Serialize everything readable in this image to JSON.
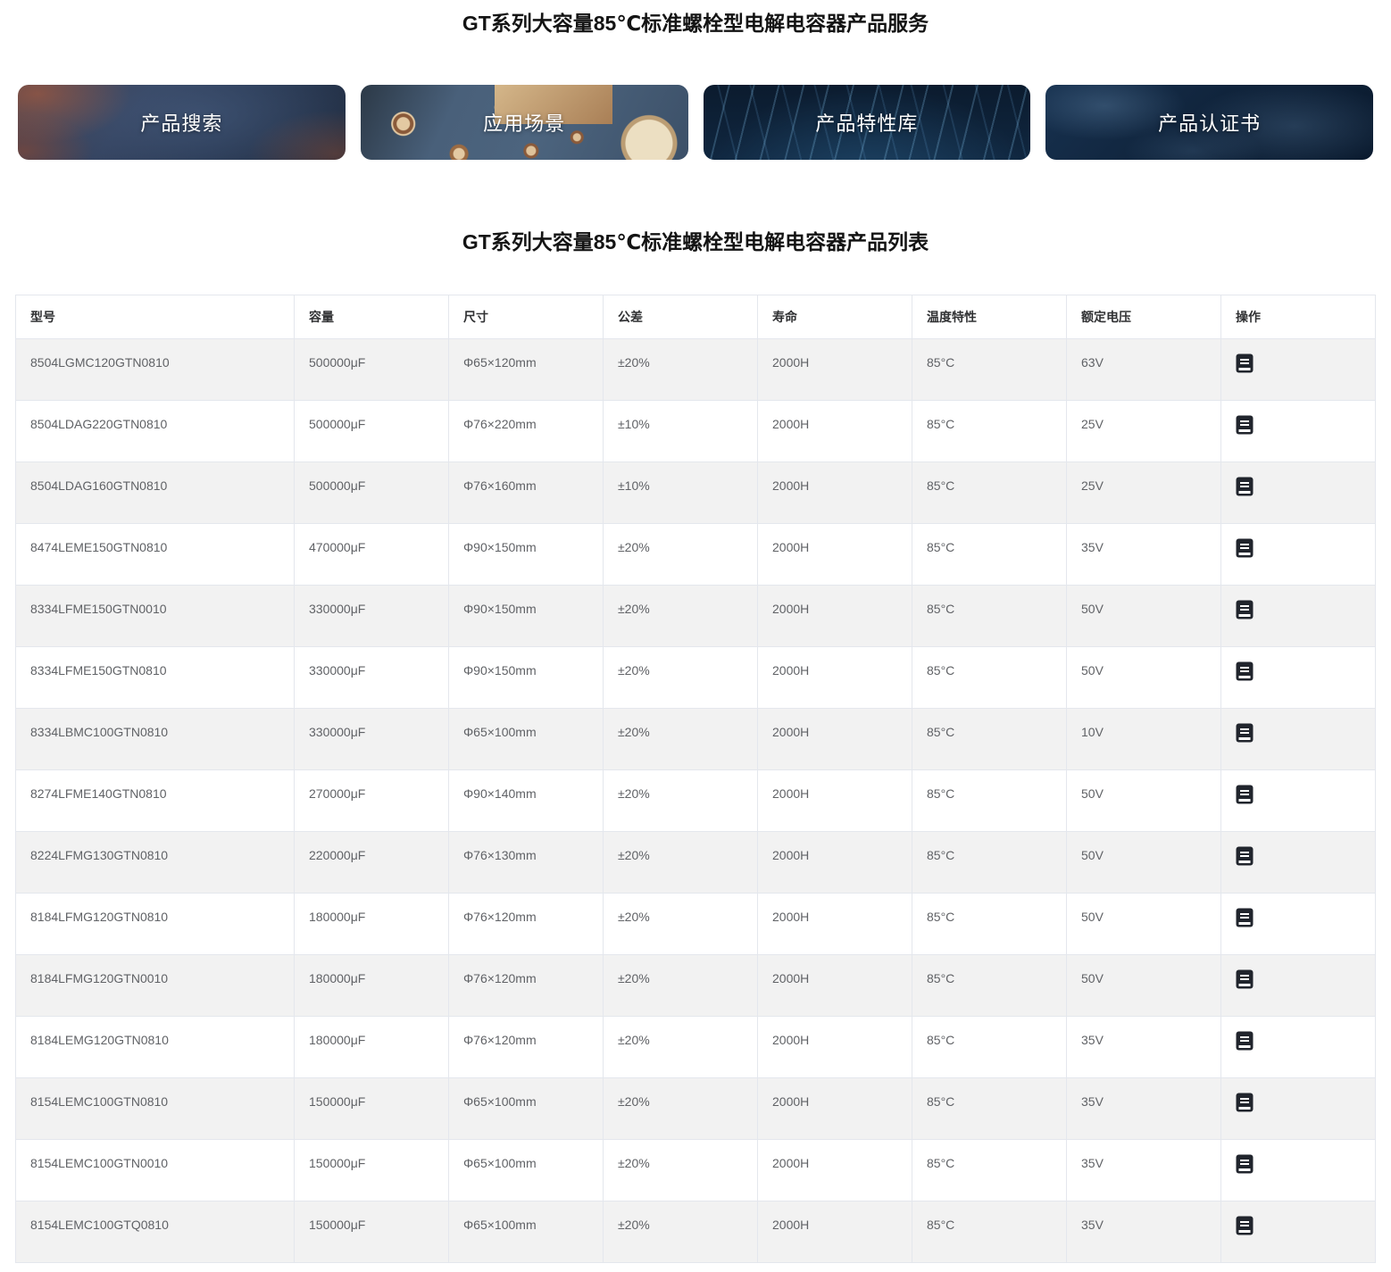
{
  "titles": {
    "service": "GT系列大容量85℃标准螺栓型电解电容器产品服务",
    "list": "GT系列大容量85℃标准螺栓型电解电容器产品列表"
  },
  "nav_cards": [
    {
      "id": "product-search",
      "label": "产品搜索"
    },
    {
      "id": "application-scenes",
      "label": "应用场景"
    },
    {
      "id": "feature-library",
      "label": "产品特性库"
    },
    {
      "id": "certificates",
      "label": "产品认证书"
    }
  ],
  "table": {
    "columns": [
      {
        "key": "model",
        "label": "型号"
      },
      {
        "key": "capacity",
        "label": "容量"
      },
      {
        "key": "size",
        "label": "尺寸"
      },
      {
        "key": "tolerance",
        "label": "公差"
      },
      {
        "key": "life",
        "label": "寿命"
      },
      {
        "key": "temperature",
        "label": "温度特性"
      },
      {
        "key": "voltage",
        "label": "额定电压"
      },
      {
        "key": "action",
        "label": "操作"
      }
    ],
    "action_icon": "document-icon",
    "rows": [
      {
        "model": "8504LGMC120GTN0810",
        "capacity": "500000μF",
        "size": "Φ65×120mm",
        "tolerance": "±20%",
        "life": "2000H",
        "temperature": "85°C",
        "voltage": "63V"
      },
      {
        "model": "8504LDAG220GTN0810",
        "capacity": "500000μF",
        "size": "Φ76×220mm",
        "tolerance": "±10%",
        "life": "2000H",
        "temperature": "85°C",
        "voltage": "25V"
      },
      {
        "model": "8504LDAG160GTN0810",
        "capacity": "500000μF",
        "size": "Φ76×160mm",
        "tolerance": "±10%",
        "life": "2000H",
        "temperature": "85°C",
        "voltage": "25V"
      },
      {
        "model": "8474LEME150GTN0810",
        "capacity": "470000μF",
        "size": "Φ90×150mm",
        "tolerance": "±20%",
        "life": "2000H",
        "temperature": "85°C",
        "voltage": "35V"
      },
      {
        "model": "8334LFME150GTN0010",
        "capacity": "330000μF",
        "size": "Φ90×150mm",
        "tolerance": "±20%",
        "life": "2000H",
        "temperature": "85°C",
        "voltage": "50V"
      },
      {
        "model": "8334LFME150GTN0810",
        "capacity": "330000μF",
        "size": "Φ90×150mm",
        "tolerance": "±20%",
        "life": "2000H",
        "temperature": "85°C",
        "voltage": "50V"
      },
      {
        "model": "8334LBMC100GTN0810",
        "capacity": "330000μF",
        "size": "Φ65×100mm",
        "tolerance": "±20%",
        "life": "2000H",
        "temperature": "85°C",
        "voltage": "10V"
      },
      {
        "model": "8274LFME140GTN0810",
        "capacity": "270000μF",
        "size": "Φ90×140mm",
        "tolerance": "±20%",
        "life": "2000H",
        "temperature": "85°C",
        "voltage": "50V"
      },
      {
        "model": "8224LFMG130GTN0810",
        "capacity": "220000μF",
        "size": "Φ76×130mm",
        "tolerance": "±20%",
        "life": "2000H",
        "temperature": "85°C",
        "voltage": "50V"
      },
      {
        "model": "8184LFMG120GTN0810",
        "capacity": "180000μF",
        "size": "Φ76×120mm",
        "tolerance": "±20%",
        "life": "2000H",
        "temperature": "85°C",
        "voltage": "50V"
      },
      {
        "model": "8184LFMG120GTN0010",
        "capacity": "180000μF",
        "size": "Φ76×120mm",
        "tolerance": "±20%",
        "life": "2000H",
        "temperature": "85°C",
        "voltage": "50V"
      },
      {
        "model": "8184LEMG120GTN0810",
        "capacity": "180000μF",
        "size": "Φ76×120mm",
        "tolerance": "±20%",
        "life": "2000H",
        "temperature": "85°C",
        "voltage": "35V"
      },
      {
        "model": "8154LEMC100GTN0810",
        "capacity": "150000μF",
        "size": "Φ65×100mm",
        "tolerance": "±20%",
        "life": "2000H",
        "temperature": "85°C",
        "voltage": "35V"
      },
      {
        "model": "8154LEMC100GTN0010",
        "capacity": "150000μF",
        "size": "Φ65×100mm",
        "tolerance": "±20%",
        "life": "2000H",
        "temperature": "85°C",
        "voltage": "35V"
      },
      {
        "model": "8154LEMC100GTQ0810",
        "capacity": "150000μF",
        "size": "Φ65×100mm",
        "tolerance": "±20%",
        "life": "2000H",
        "temperature": "85°C",
        "voltage": "35V"
      }
    ]
  },
  "colors": {
    "stripe_row": "#f2f2f2",
    "table_border": "#e4e7ed",
    "body_text": "#606266",
    "header_text": "#303133",
    "action_icon_fill": "#21252d"
  }
}
